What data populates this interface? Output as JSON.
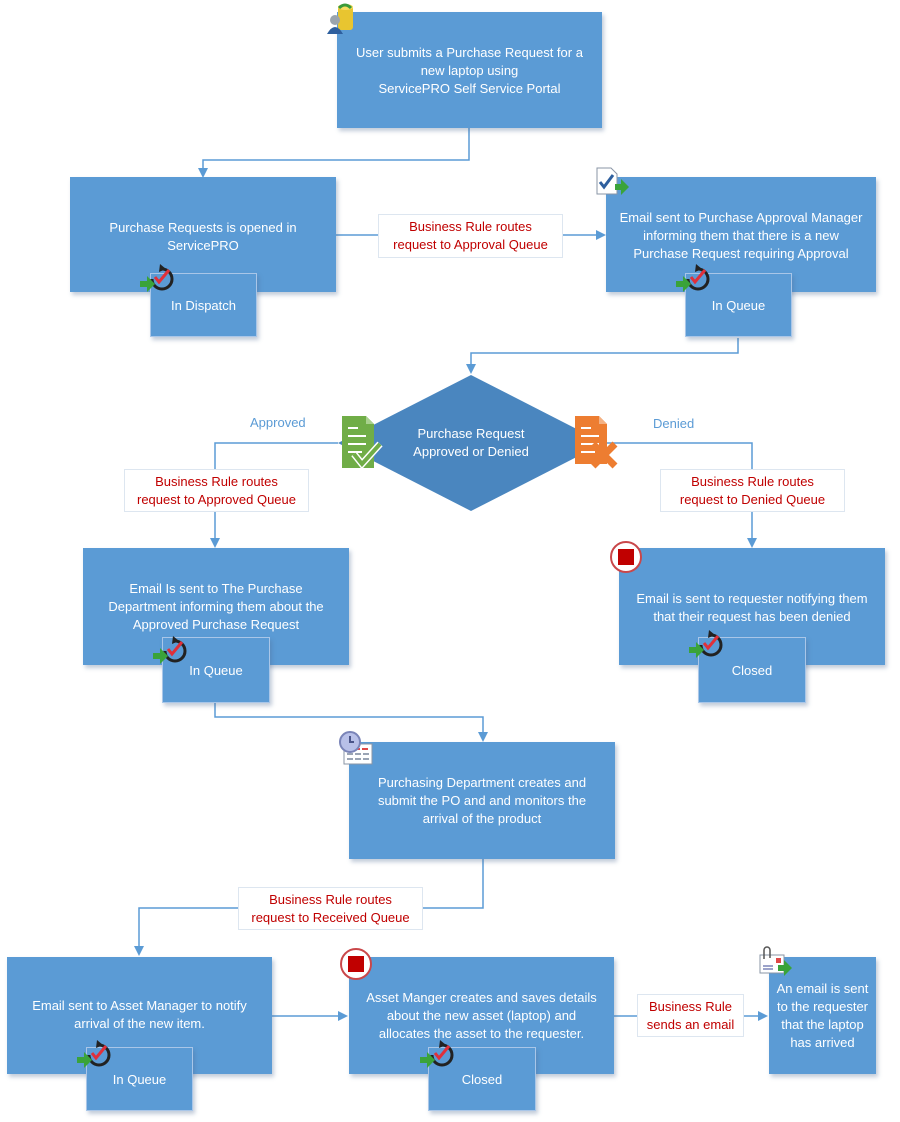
{
  "diagram": {
    "colors": {
      "box_fill": "#5b9bd5",
      "decision_fill": "#4a86bf",
      "connector": "#5b9bd5",
      "rule_text": "#c00000",
      "branch_label": "#5b9bd5"
    },
    "steps": {
      "submit": {
        "text": "User submits a Purchase Request for a\nnew laptop using\nServicePRO Self Service Portal",
        "icon": "user-database-icon"
      },
      "opened": {
        "text": "Purchase Requests is opened in\nServicePRO",
        "status": "In Dispatch",
        "status_icon": "workflow-status-icon"
      },
      "email_manager": {
        "text": "Email sent to Purchase Approval Manager\ninforming them that there is a new\nPurchase Request requiring Approval",
        "status": "In Queue",
        "icon": "approval-document-icon",
        "status_icon": "workflow-status-icon"
      },
      "decision": {
        "text": "Purchase Request\nApproved or Denied",
        "approved_label": "Approved",
        "denied_label": "Denied",
        "approved_icon": "document-approved-icon",
        "denied_icon": "document-denied-icon"
      },
      "email_purchase": {
        "text": "Email Is sent to The Purchase\nDepartment informing them about the\nApproved Purchase Request",
        "status": "In Queue",
        "status_icon": "workflow-status-icon"
      },
      "email_denied": {
        "text": "Email is sent to requester notifying them\nthat their request has been denied",
        "status": "Closed",
        "icon": "stop-icon",
        "status_icon": "workflow-status-icon"
      },
      "purchasing": {
        "text": "Purchasing Department creates and\nsubmit the PO and  and monitors the\narrival of the product",
        "icon": "schedule-calendar-icon"
      },
      "email_asset": {
        "text": "Email sent to Asset Manager to notify\narrival of the new item.",
        "status": "In Queue",
        "status_icon": "workflow-status-icon"
      },
      "asset_manager": {
        "text": "Asset Manger creates and saves details\nabout the new asset (laptop) and\nallocates the asset to the requester.",
        "status": "Closed",
        "icon": "stop-icon",
        "status_icon": "workflow-status-icon"
      },
      "email_arrived": {
        "text": "An email is sent\nto the requester\nthat the laptop\nhas arrived",
        "icon": "email-attachment-send-icon"
      }
    },
    "rules": {
      "approval_queue": "Business Rule routes\nrequest to Approval Queue",
      "approved_queue": "Business Rule routes\nrequest to Approved Queue",
      "denied_queue": "Business Rule routes\nrequest to Denied Queue",
      "received_queue": "Business Rule routes\nrequest to Received Queue",
      "sends_email": "Business Rule\nsends an email"
    }
  }
}
